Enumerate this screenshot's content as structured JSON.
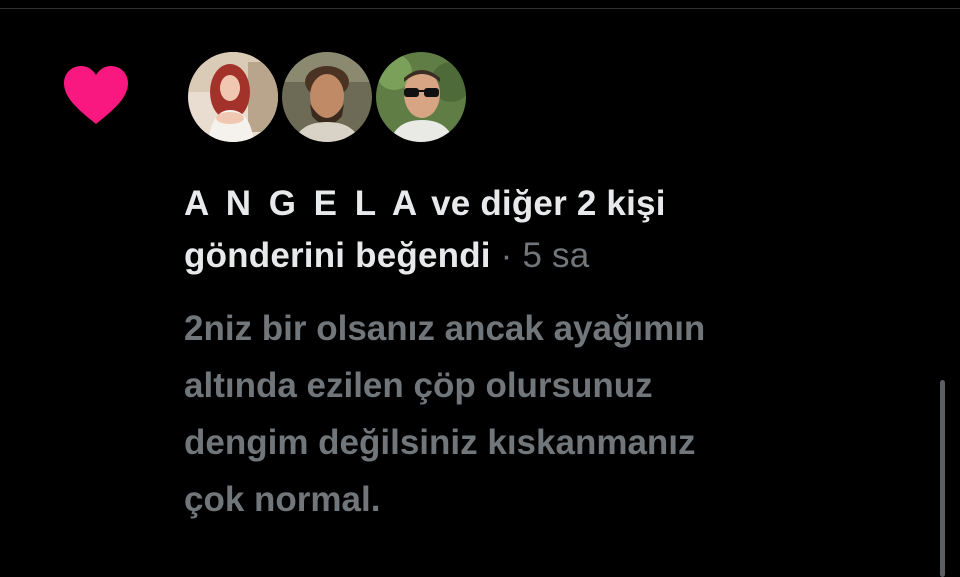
{
  "notification": {
    "type_icon": "heart-icon",
    "like_color": "#f91880",
    "avatars": [
      {
        "label": "user-avatar-angela",
        "icon": "person-photo"
      },
      {
        "label": "user-avatar-2",
        "icon": "person-photo"
      },
      {
        "label": "user-avatar-3",
        "icon": "person-photo"
      }
    ],
    "name": "A N G E L A",
    "action_line1": " ve diğer 2 kişi",
    "action_line2": "gönderini beğendi",
    "separator": " · ",
    "time": "5 sa"
  },
  "tweet": {
    "text": "2niz bir olsanız ancak ayağımın\naltında ezilen çöp olursunuz\ndengim değilsiniz kıskanmanız\nçok normal."
  },
  "colors": {
    "background": "#000000",
    "primary_text": "#e7e9ea",
    "secondary_text": "#71767b"
  }
}
